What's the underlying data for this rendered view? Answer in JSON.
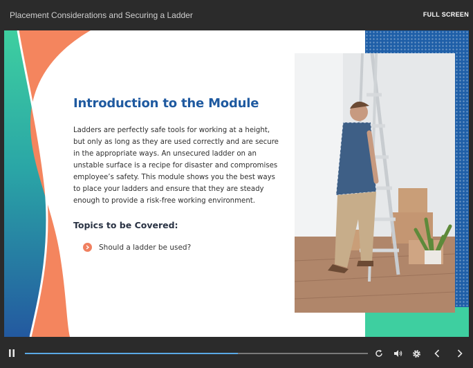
{
  "window": {
    "title": "Placement Considerations and Securing a Ladder",
    "fullscreen_label": "FULL SCREEN"
  },
  "slide": {
    "heading": "Introduction to the Module",
    "body": "Ladders are perfectly safe tools for working at a height, but only as long as they are used correctly and are secure in the appropriate ways. An unsecured ladder on an unstable surface is a recipe for disaster and compromises employee’s safety. This module shows you the best ways to place your ladders and ensure that they are steady enough to provide a risk-free working environment.",
    "topics_heading": "Topics to be Covered:",
    "topics": [
      {
        "label": "Should a ladder be used?",
        "icon": "chevron-right-icon"
      }
    ],
    "image": {
      "subject": "man-climbing-stepladder-photo"
    }
  },
  "player": {
    "progress": 0.62,
    "icons": [
      "pause-icon",
      "replay-icon",
      "volume-icon",
      "settings-icon",
      "previous-icon",
      "next-icon"
    ]
  },
  "colors": {
    "accent_blue": "#1f5aa0",
    "accent_orange": "#f08060",
    "accent_teal": "#3ecfa0",
    "progress_fill": "#5aa9e6"
  }
}
